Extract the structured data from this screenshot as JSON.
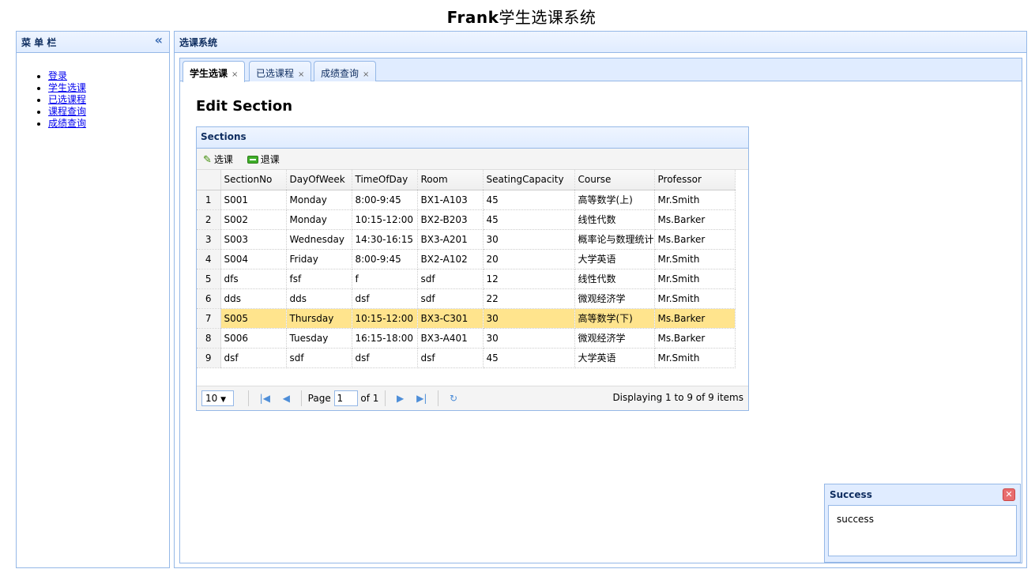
{
  "app": {
    "title_en": "Frank",
    "title_cn": "学生选课系统"
  },
  "menu": {
    "title": "菜 单 栏",
    "collapse_icon": "«",
    "items": [
      {
        "label": "登录"
      },
      {
        "label": "学生选课"
      },
      {
        "label": "已选课程"
      },
      {
        "label": "课程查询"
      },
      {
        "label": "成绩查询"
      }
    ]
  },
  "center": {
    "title": "选课系统"
  },
  "tabs": [
    {
      "label": "学生选课",
      "close": "×"
    },
    {
      "label": "已选课程",
      "close": "×"
    },
    {
      "label": "成绩查询",
      "close": "×"
    }
  ],
  "page": {
    "heading": "Edit Section"
  },
  "grid": {
    "title": "Sections",
    "toolbar": {
      "select_label": "选课",
      "drop_label": "退课"
    },
    "columns": [
      "SectionNo",
      "DayOfWeek",
      "TimeOfDay",
      "Room",
      "SeatingCapacity",
      "Course",
      "Professor"
    ],
    "rows": [
      {
        "n": "1",
        "cells": [
          "S001",
          "Monday",
          "8:00-9:45",
          "BX1-A103",
          "45",
          "高等数学(上)",
          "Mr.Smith"
        ]
      },
      {
        "n": "2",
        "cells": [
          "S002",
          "Monday",
          "10:15-12:00",
          "BX2-B203",
          "45",
          "线性代数",
          "Ms.Barker"
        ]
      },
      {
        "n": "3",
        "cells": [
          "S003",
          "Wednesday",
          "14:30-16:15",
          "BX3-A201",
          "30",
          "概率论与数理统计",
          "Ms.Barker"
        ]
      },
      {
        "n": "4",
        "cells": [
          "S004",
          "Friday",
          "8:00-9:45",
          "BX2-A102",
          "20",
          "大学英语",
          "Mr.Smith"
        ]
      },
      {
        "n": "5",
        "cells": [
          "dfs",
          "fsf",
          "f",
          "sdf",
          "12",
          "线性代数",
          "Mr.Smith"
        ]
      },
      {
        "n": "6",
        "cells": [
          "dds",
          "dds",
          "dsf",
          "sdf",
          "22",
          "微观经济学",
          "Mr.Smith"
        ]
      },
      {
        "n": "7",
        "cells": [
          "S005",
          "Thursday",
          "10:15-12:00",
          "BX3-C301",
          "30",
          "高等数学(下)",
          "Ms.Barker"
        ]
      },
      {
        "n": "8",
        "cells": [
          "S006",
          "Tuesday",
          "16:15-18:00",
          "BX3-A401",
          "30",
          "微观经济学",
          "Ms.Barker"
        ]
      },
      {
        "n": "9",
        "cells": [
          "dsf",
          "sdf",
          "dsf",
          "dsf",
          "45",
          "大学英语",
          "Mr.Smith"
        ]
      }
    ],
    "selected_row": 7,
    "pager": {
      "page_size": "10",
      "page_label": "Page",
      "page_value": "1",
      "of_label": "of 1",
      "info": "Displaying 1 to 9 of 9 items"
    }
  },
  "message": {
    "title": "Success",
    "body": "success"
  },
  "colors": {
    "border": "#95b8e7",
    "header_bg": "#e0ecff",
    "selected_row": "#ffe48d"
  }
}
